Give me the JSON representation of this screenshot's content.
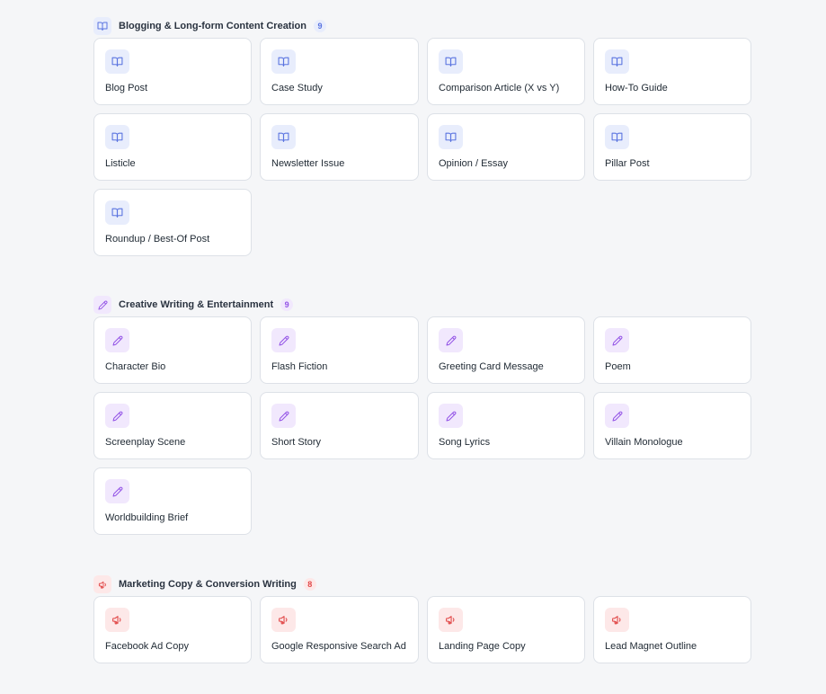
{
  "sections": [
    {
      "title": "Blogging & Long-form Content Creation",
      "count": "9",
      "icon": "book-icon",
      "accent": "#5a74e0",
      "items": [
        {
          "label": "Blog Post"
        },
        {
          "label": "Case Study"
        },
        {
          "label": "Comparison Article (X vs Y)"
        },
        {
          "label": "How-To Guide"
        },
        {
          "label": "Listicle"
        },
        {
          "label": "Newsletter Issue"
        },
        {
          "label": "Opinion / Essay"
        },
        {
          "label": "Pillar Post"
        },
        {
          "label": "Roundup / Best-Of Post"
        }
      ]
    },
    {
      "title": "Creative Writing & Entertainment",
      "count": "9",
      "icon": "pencil-icon",
      "accent": "#9353e6",
      "items": [
        {
          "label": "Character Bio"
        },
        {
          "label": "Flash Fiction"
        },
        {
          "label": "Greeting Card Message"
        },
        {
          "label": "Poem"
        },
        {
          "label": "Screenplay Scene"
        },
        {
          "label": "Short Story"
        },
        {
          "label": "Song Lyrics"
        },
        {
          "label": "Villain Monologue"
        },
        {
          "label": "Worldbuilding Brief"
        }
      ]
    },
    {
      "title": "Marketing Copy & Conversion Writing",
      "count": "8",
      "icon": "megaphone-icon",
      "accent": "#e14848",
      "items": [
        {
          "label": "Facebook Ad Copy"
        },
        {
          "label": "Google Responsive Search Ad"
        },
        {
          "label": "Landing Page Copy"
        },
        {
          "label": "Lead Magnet Outline"
        }
      ]
    }
  ]
}
